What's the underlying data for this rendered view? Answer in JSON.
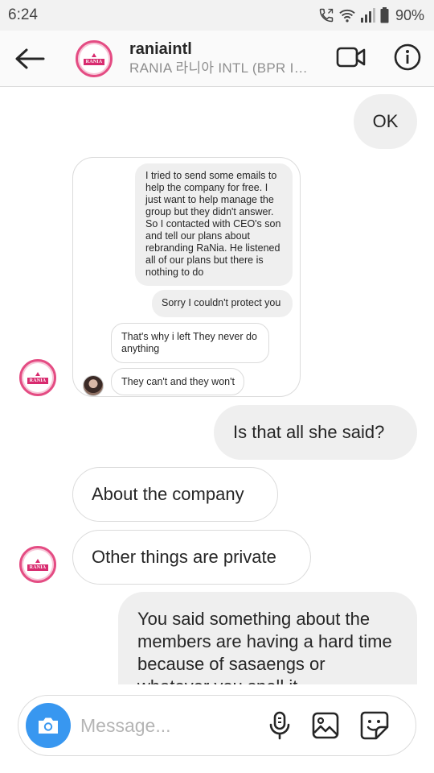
{
  "status_bar": {
    "time": "6:24",
    "battery": "90%"
  },
  "header": {
    "username": "raniaintl",
    "full_name": "RANIA 라니아 INTL (BPR IN...",
    "avatar_text": "RANIA"
  },
  "messages": [
    {
      "direction": "out",
      "text": "OK"
    },
    {
      "direction": "in",
      "type": "shared_screenshot",
      "inner_messages": [
        {
          "direction": "out",
          "text": "I tried to send some emails to help the company for free. I just want to help manage the group but they didn't answer. So I contacted with CEO's son and tell our plans about rebranding RaNia. He listened all of our plans but there is nothing to do"
        },
        {
          "direction": "out",
          "text": "Sorry I couldn't protect you"
        },
        {
          "direction": "in",
          "text": "That's why i left They never do anything"
        },
        {
          "direction": "in",
          "text": "They can't and they won't"
        }
      ]
    },
    {
      "direction": "out",
      "text": "Is that all she said?"
    },
    {
      "direction": "in",
      "text": "About the company"
    },
    {
      "direction": "in",
      "text": "Other things are private"
    },
    {
      "direction": "out",
      "text": "You said something about the members are having a hard time because of sasaengs or whatever you spell it"
    }
  ],
  "composer": {
    "placeholder": "Message..."
  },
  "colors": {
    "accent": "#3897f0",
    "outgoing_bubble": "#efefef",
    "incoming_border": "#dbdbdb",
    "logo_pink": "#d82b6f"
  },
  "icons": [
    "back-arrow-icon",
    "video-call-icon",
    "info-icon",
    "camera-icon",
    "microphone-icon",
    "gallery-icon",
    "sticker-icon",
    "wifi-icon",
    "signal-icon",
    "battery-icon",
    "call-icon"
  ]
}
